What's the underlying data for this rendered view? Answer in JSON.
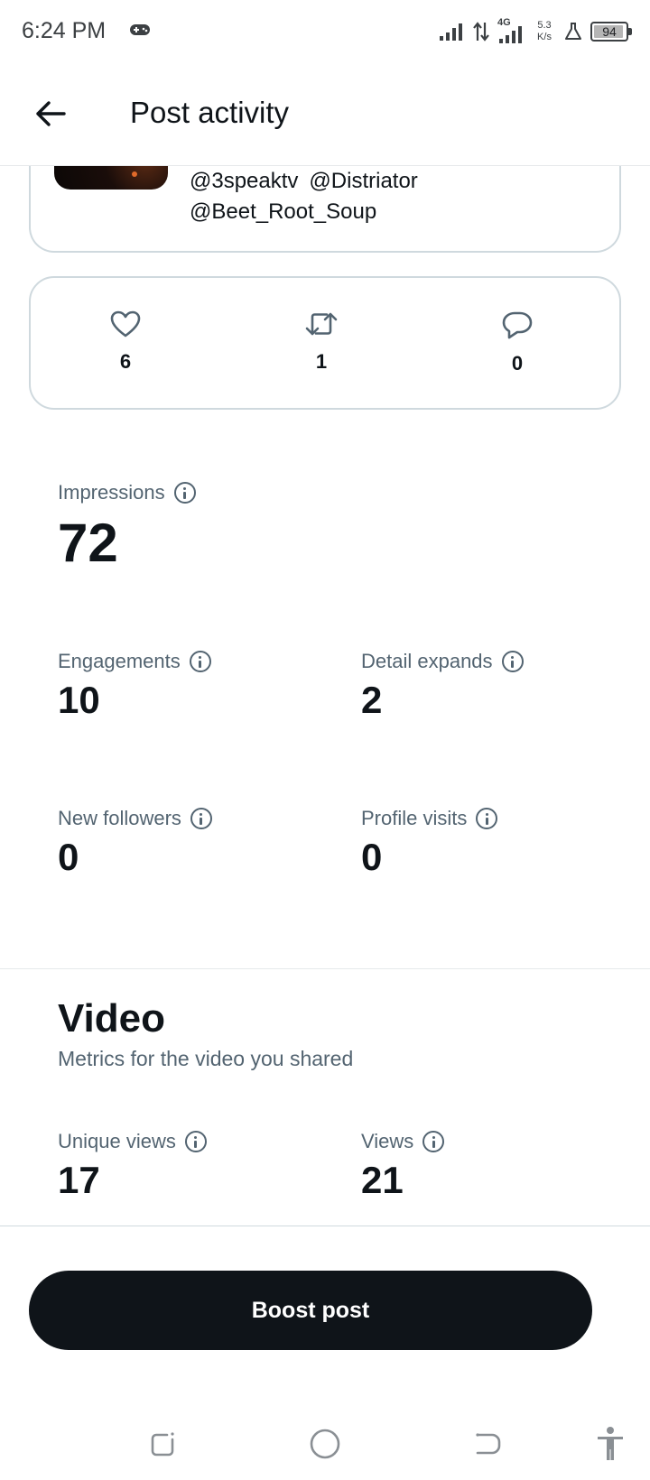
{
  "status_bar": {
    "time": "6:24 PM",
    "net_speed_value": "5.3",
    "net_speed_unit": "K/s",
    "network_type": "4G",
    "battery_level": "94"
  },
  "header": {
    "title": "Post activity"
  },
  "post": {
    "mentions": [
      "@3speaktv",
      "@Distriator",
      "@Beet_Root_Soup"
    ]
  },
  "engagement": {
    "likes": "6",
    "reposts": "1",
    "replies": "0"
  },
  "metrics": {
    "impressions": {
      "label": "Impressions",
      "value": "72"
    },
    "engagements": {
      "label": "Engagements",
      "value": "10"
    },
    "detail_expands": {
      "label": "Detail expands",
      "value": "2"
    },
    "new_followers": {
      "label": "New followers",
      "value": "0"
    },
    "profile_visits": {
      "label": "Profile visits",
      "value": "0"
    }
  },
  "video": {
    "title": "Video",
    "subtitle": "Metrics for the video you shared",
    "unique_views": {
      "label": "Unique views",
      "value": "17"
    },
    "views": {
      "label": "Views",
      "value": "21"
    }
  },
  "boost_button_label": "Boost post",
  "colors": {
    "text_primary": "#0f1419",
    "text_secondary": "#536471",
    "border": "#cfd9de",
    "button_bg": "#0f1419"
  },
  "icons": {
    "back": "arrow-left-icon",
    "like": "heart-icon",
    "repost": "repost-icon",
    "reply": "reply-bubble-icon",
    "info": "info-icon"
  }
}
